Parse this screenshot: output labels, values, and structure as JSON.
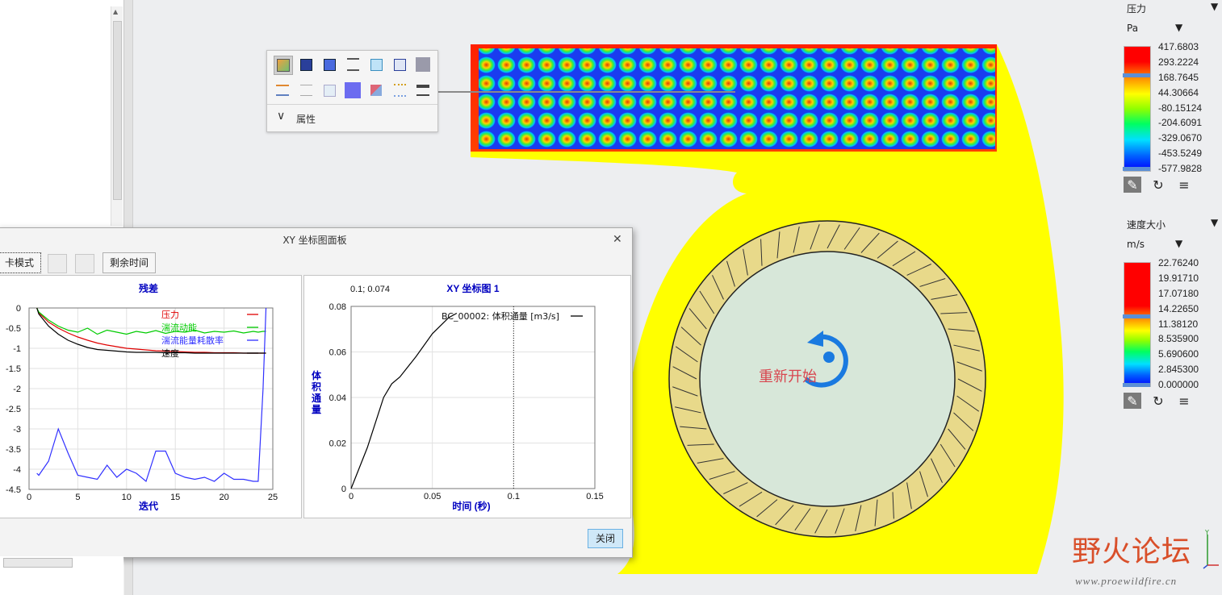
{
  "viewport": {
    "overlay_text": "重新开始",
    "colors": {
      "fan_body": "#ffff00",
      "viewport_bg": "#edeef0"
    }
  },
  "mini_toolbar": {
    "properties_label": "属性",
    "row1_icons": [
      "shaded-cube-icon",
      "solid-cube-icon",
      "edges-cube-icon",
      "list-icon",
      "transparent-cube-icon",
      "settings-cube-icon",
      "color-swatch-icon"
    ],
    "row2_icons": [
      "flow-arrows-icon",
      "list-outline-icon",
      "ghost-cube-icon",
      "blue-square-icon",
      "checker-icon",
      "dotted-list-icon",
      "menu-icon"
    ]
  },
  "legend_pressure": {
    "title": "压力",
    "unit": "Pa",
    "values": [
      "417.6803",
      "293.2224",
      "168.7645",
      "44.30664",
      "-80.15124",
      "-204.6091",
      "-329.0670",
      "-453.5249",
      "-577.9828"
    ]
  },
  "legend_velocity": {
    "title": "速度大小",
    "unit": "m/s",
    "values": [
      "22.76240",
      "19.91710",
      "17.07180",
      "14.22650",
      "11.38120",
      "8.535900",
      "5.690600",
      "2.845300",
      "0.000000"
    ]
  },
  "dialog": {
    "title": "XY 坐标图面板",
    "mode_button": "卡模式",
    "time_button": "剩余时间",
    "close_button": "关闭"
  },
  "chart_data": [
    {
      "type": "line",
      "title": "残差",
      "xlabel": "迭代",
      "ylabel": "",
      "xlim": [
        0,
        25
      ],
      "ylim": [
        -4.5,
        0
      ],
      "xticks": [
        "0",
        "5",
        "10",
        "15",
        "20",
        "25"
      ],
      "yticks": [
        "0",
        "-0.5",
        "-1",
        "-1.5",
        "-2",
        "-2.5",
        "-3",
        "-3.5",
        "-4",
        "-4.5"
      ],
      "x": [
        0.8,
        1,
        2,
        3,
        4,
        5,
        6,
        7,
        8,
        9,
        10,
        11,
        12,
        13,
        14,
        15,
        16,
        17,
        18,
        19,
        20,
        21,
        22,
        23,
        23.5,
        24,
        24.3
      ],
      "series": [
        {
          "name": "压力",
          "color": "#e00000",
          "values": [
            0,
            -0.12,
            -0.35,
            -0.5,
            -0.62,
            -0.72,
            -0.8,
            -0.87,
            -0.92,
            -0.96,
            -1.0,
            -1.02,
            -1.04,
            -1.06,
            -1.07,
            -1.08,
            -1.09,
            -1.1,
            -1.1,
            -1.11,
            -1.11,
            -1.11,
            -1.12,
            -1.12,
            -1.12,
            -1.12,
            -1.12
          ]
        },
        {
          "name": "湍流动能",
          "color": "#00cc00",
          "values": [
            0,
            -0.1,
            -0.3,
            -0.45,
            -0.55,
            -0.6,
            -0.5,
            -0.65,
            -0.55,
            -0.6,
            -0.65,
            -0.58,
            -0.62,
            -0.56,
            -0.63,
            -0.58,
            -0.6,
            -0.55,
            -0.62,
            -0.58,
            -0.6,
            -0.57,
            -0.62,
            -0.58,
            -0.6,
            -0.58,
            -0.58
          ]
        },
        {
          "name": "湍流能量耗散率",
          "color": "#3030ff",
          "values": [
            -4.1,
            -4.15,
            -3.8,
            -3.0,
            -3.6,
            -4.15,
            -4.2,
            -4.25,
            -3.9,
            -4.2,
            -4.0,
            -4.1,
            -4.3,
            -3.55,
            -3.55,
            -4.1,
            -4.2,
            -4.25,
            -4.2,
            -4.3,
            -4.1,
            -4.25,
            -4.25,
            -4.3,
            -4.3,
            -2.0,
            0
          ]
        },
        {
          "name": "速度",
          "color": "#000000",
          "values": [
            0,
            -0.15,
            -0.45,
            -0.65,
            -0.8,
            -0.9,
            -0.98,
            -1.03,
            -1.05,
            -1.07,
            -1.09,
            -1.1,
            -1.1,
            -1.1,
            -1.11,
            -1.11,
            -1.11,
            -1.12,
            -1.12,
            -1.12,
            -1.12,
            -1.12,
            -1.12,
            -1.12,
            -1.12,
            -1.12,
            -1.12
          ]
        }
      ]
    },
    {
      "type": "line",
      "title": "XY 坐标图 1",
      "readout": "0.1; 0.074",
      "xlabel": "时间 (秒)",
      "ylabel": "体积通量",
      "xlim": [
        0,
        0.15
      ],
      "ylim": [
        0,
        0.08
      ],
      "xticks": [
        "0",
        "0.05",
        "0.1",
        "0.15"
      ],
      "yticks": [
        "0",
        "0.02",
        "0.04",
        "0.06",
        "0.08"
      ],
      "cursor_x": 0.1,
      "series": [
        {
          "name": "BC_00002: 体积通量 [m3/s]",
          "color": "#000000",
          "x": [
            0,
            0.01,
            0.02,
            0.025,
            0.03,
            0.04,
            0.05,
            0.06,
            0.065
          ],
          "values": [
            0,
            0.018,
            0.04,
            0.046,
            0.049,
            0.058,
            0.068,
            0.075,
            0.077
          ]
        }
      ]
    }
  ],
  "watermark": {
    "text": "野火论坛",
    "url": "www.proewildfire.cn"
  }
}
